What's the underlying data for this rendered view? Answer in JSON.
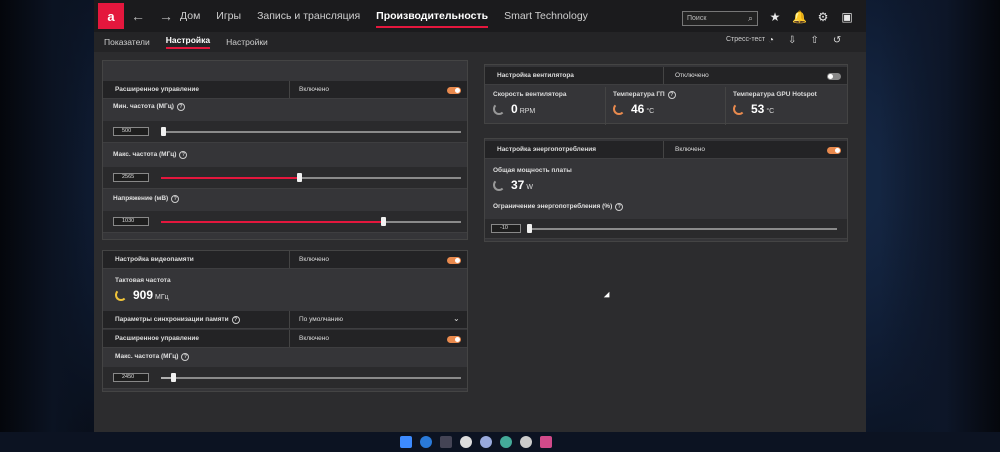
{
  "nav": {
    "items": [
      "Дом",
      "Игры",
      "Запись и трансляция",
      "Производительность",
      "Smart Technology"
    ],
    "search_placeholder": "Поиск"
  },
  "subnav": {
    "tabs": [
      "Показатели",
      "Настройка",
      "Настройки"
    ],
    "stress_test": "Стресс-тест"
  },
  "gpu_panel": {
    "extended_control": {
      "label": "Расширенное управление",
      "value": "Включено"
    },
    "min_freq": {
      "label": "Мин. частота (МГц)",
      "value": "500",
      "fraction": 0.0
    },
    "max_freq": {
      "label": "Макс. частота (МГц)",
      "value": "2565",
      "fraction": 0.46
    },
    "voltage": {
      "label": "Напряжение (мВ)",
      "value": "1030",
      "fraction": 0.74
    }
  },
  "vram_panel": {
    "tuning": {
      "label": "Настройка видеопамяти",
      "value": "Включено"
    },
    "clock_label": "Тактовая частота",
    "clock_value": "909",
    "clock_unit": "МГц",
    "timing": {
      "label": "Параметры синхронизации памяти",
      "value": "По умолчанию"
    },
    "extended_control": {
      "label": "Расширенное управление",
      "value": "Включено"
    },
    "max_freq": {
      "label": "Макс. частота (МГц)",
      "value": "2450",
      "fraction": 0.04
    }
  },
  "fan_panel": {
    "tuning": {
      "label": "Настройка вентилятора",
      "value": "Отключено"
    },
    "fan_speed": {
      "label": "Скорость вентилятора",
      "value": "0",
      "unit": "RPM"
    },
    "gpu_temp": {
      "label": "Температура ГП",
      "value": "46",
      "unit": "°C"
    },
    "hotspot_temp": {
      "label": "Температура GPU Hotspot",
      "value": "53",
      "unit": "°C"
    }
  },
  "power_panel": {
    "tuning": {
      "label": "Настройка энергопотребления",
      "value": "Включено"
    },
    "board_power": {
      "label": "Общая мощность платы",
      "value": "37",
      "unit": "W"
    },
    "power_limit": {
      "label": "Ограничение энергопотребления (%)",
      "value": "-10",
      "fraction": 0.0
    }
  },
  "colors": {
    "accent": "#e4173d",
    "toggle": "#e98a4e"
  }
}
